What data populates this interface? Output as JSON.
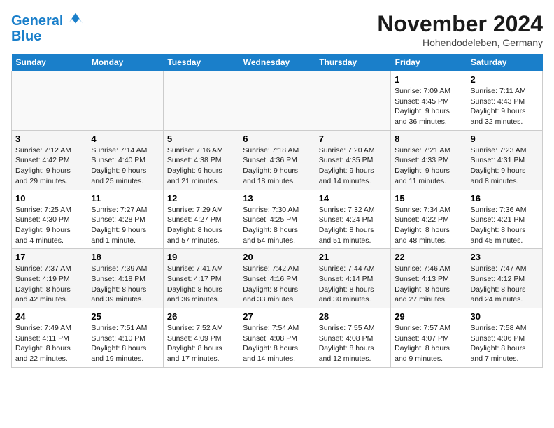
{
  "header": {
    "logo_line1": "General",
    "logo_line2": "Blue",
    "month_title": "November 2024",
    "location": "Hohendodeleben, Germany"
  },
  "weekdays": [
    "Sunday",
    "Monday",
    "Tuesday",
    "Wednesday",
    "Thursday",
    "Friday",
    "Saturday"
  ],
  "weeks": [
    [
      {
        "day": "",
        "info": ""
      },
      {
        "day": "",
        "info": ""
      },
      {
        "day": "",
        "info": ""
      },
      {
        "day": "",
        "info": ""
      },
      {
        "day": "",
        "info": ""
      },
      {
        "day": "1",
        "info": "Sunrise: 7:09 AM\nSunset: 4:45 PM\nDaylight: 9 hours and 36 minutes."
      },
      {
        "day": "2",
        "info": "Sunrise: 7:11 AM\nSunset: 4:43 PM\nDaylight: 9 hours and 32 minutes."
      }
    ],
    [
      {
        "day": "3",
        "info": "Sunrise: 7:12 AM\nSunset: 4:42 PM\nDaylight: 9 hours and 29 minutes."
      },
      {
        "day": "4",
        "info": "Sunrise: 7:14 AM\nSunset: 4:40 PM\nDaylight: 9 hours and 25 minutes."
      },
      {
        "day": "5",
        "info": "Sunrise: 7:16 AM\nSunset: 4:38 PM\nDaylight: 9 hours and 21 minutes."
      },
      {
        "day": "6",
        "info": "Sunrise: 7:18 AM\nSunset: 4:36 PM\nDaylight: 9 hours and 18 minutes."
      },
      {
        "day": "7",
        "info": "Sunrise: 7:20 AM\nSunset: 4:35 PM\nDaylight: 9 hours and 14 minutes."
      },
      {
        "day": "8",
        "info": "Sunrise: 7:21 AM\nSunset: 4:33 PM\nDaylight: 9 hours and 11 minutes."
      },
      {
        "day": "9",
        "info": "Sunrise: 7:23 AM\nSunset: 4:31 PM\nDaylight: 9 hours and 8 minutes."
      }
    ],
    [
      {
        "day": "10",
        "info": "Sunrise: 7:25 AM\nSunset: 4:30 PM\nDaylight: 9 hours and 4 minutes."
      },
      {
        "day": "11",
        "info": "Sunrise: 7:27 AM\nSunset: 4:28 PM\nDaylight: 9 hours and 1 minute."
      },
      {
        "day": "12",
        "info": "Sunrise: 7:29 AM\nSunset: 4:27 PM\nDaylight: 8 hours and 57 minutes."
      },
      {
        "day": "13",
        "info": "Sunrise: 7:30 AM\nSunset: 4:25 PM\nDaylight: 8 hours and 54 minutes."
      },
      {
        "day": "14",
        "info": "Sunrise: 7:32 AM\nSunset: 4:24 PM\nDaylight: 8 hours and 51 minutes."
      },
      {
        "day": "15",
        "info": "Sunrise: 7:34 AM\nSunset: 4:22 PM\nDaylight: 8 hours and 48 minutes."
      },
      {
        "day": "16",
        "info": "Sunrise: 7:36 AM\nSunset: 4:21 PM\nDaylight: 8 hours and 45 minutes."
      }
    ],
    [
      {
        "day": "17",
        "info": "Sunrise: 7:37 AM\nSunset: 4:19 PM\nDaylight: 8 hours and 42 minutes."
      },
      {
        "day": "18",
        "info": "Sunrise: 7:39 AM\nSunset: 4:18 PM\nDaylight: 8 hours and 39 minutes."
      },
      {
        "day": "19",
        "info": "Sunrise: 7:41 AM\nSunset: 4:17 PM\nDaylight: 8 hours and 36 minutes."
      },
      {
        "day": "20",
        "info": "Sunrise: 7:42 AM\nSunset: 4:16 PM\nDaylight: 8 hours and 33 minutes."
      },
      {
        "day": "21",
        "info": "Sunrise: 7:44 AM\nSunset: 4:14 PM\nDaylight: 8 hours and 30 minutes."
      },
      {
        "day": "22",
        "info": "Sunrise: 7:46 AM\nSunset: 4:13 PM\nDaylight: 8 hours and 27 minutes."
      },
      {
        "day": "23",
        "info": "Sunrise: 7:47 AM\nSunset: 4:12 PM\nDaylight: 8 hours and 24 minutes."
      }
    ],
    [
      {
        "day": "24",
        "info": "Sunrise: 7:49 AM\nSunset: 4:11 PM\nDaylight: 8 hours and 22 minutes."
      },
      {
        "day": "25",
        "info": "Sunrise: 7:51 AM\nSunset: 4:10 PM\nDaylight: 8 hours and 19 minutes."
      },
      {
        "day": "26",
        "info": "Sunrise: 7:52 AM\nSunset: 4:09 PM\nDaylight: 8 hours and 17 minutes."
      },
      {
        "day": "27",
        "info": "Sunrise: 7:54 AM\nSunset: 4:08 PM\nDaylight: 8 hours and 14 minutes."
      },
      {
        "day": "28",
        "info": "Sunrise: 7:55 AM\nSunset: 4:08 PM\nDaylight: 8 hours and 12 minutes."
      },
      {
        "day": "29",
        "info": "Sunrise: 7:57 AM\nSunset: 4:07 PM\nDaylight: 8 hours and 9 minutes."
      },
      {
        "day": "30",
        "info": "Sunrise: 7:58 AM\nSunset: 4:06 PM\nDaylight: 8 hours and 7 minutes."
      }
    ]
  ]
}
